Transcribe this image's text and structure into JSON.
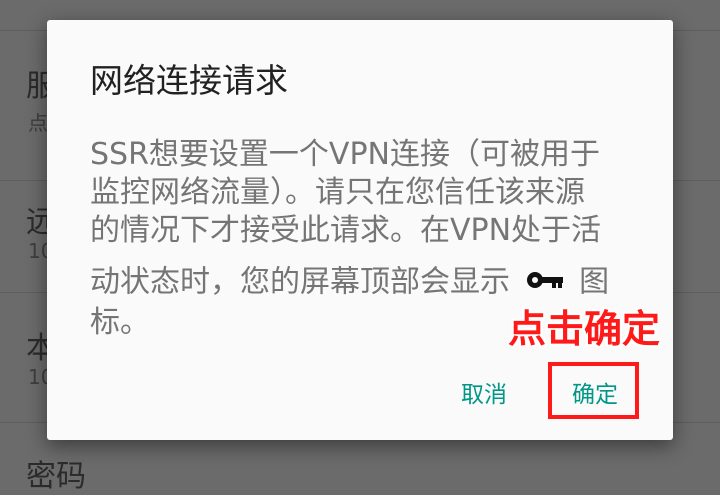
{
  "background": {
    "rows": [
      {
        "title": "服",
        "subtitle": "点"
      },
      {
        "title": "远",
        "subtitle": "10"
      },
      {
        "title": "本",
        "subtitle": "10"
      },
      {
        "title": "密码"
      }
    ]
  },
  "dialog": {
    "title": "网络连接请求",
    "message_lines": [
      "SSR想要设置一个VPN连接（可被用于",
      "监控网络流量）。请只在您信任该来源",
      "的情况下才接受此请求。在VPN处于活"
    ],
    "message_line4_before": "动状态时，您的屏幕顶部会显示",
    "message_line4_after": "图",
    "message_line5": "标。",
    "key_icon": "key-icon",
    "cancel_label": "取消",
    "ok_label": "确定"
  },
  "annotation": {
    "callout_text": "点击确定",
    "color": "#ff1a1a"
  },
  "colors": {
    "accent": "#009688",
    "scrim": "#6b6b6b",
    "dialog_bg": "#fafafa"
  }
}
